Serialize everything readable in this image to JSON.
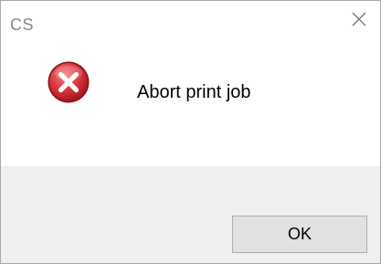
{
  "window": {
    "title": "CS",
    "close_icon": "close-icon"
  },
  "dialog": {
    "icon": "error-icon",
    "message": "Abort print job",
    "ok_label": "OK"
  },
  "colors": {
    "footer_background": "#f0f0f0",
    "button_background": "#e1e1e1",
    "error_red": "#d9363e"
  }
}
